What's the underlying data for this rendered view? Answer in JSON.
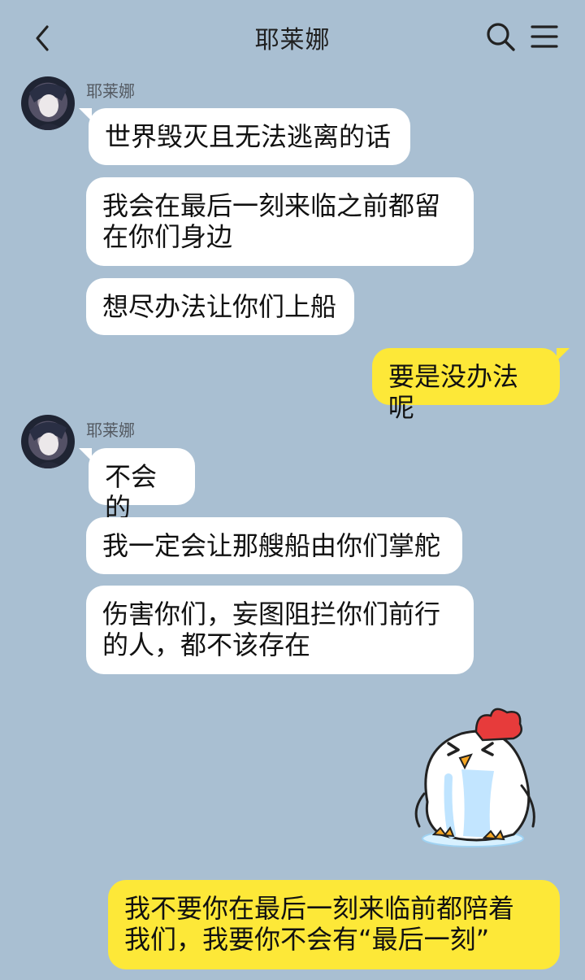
{
  "header": {
    "title": "耶莱娜",
    "back_icon": "chevron-left-icon",
    "search_icon": "search-icon",
    "menu_icon": "menu-icon"
  },
  "messages": [
    {
      "sender": "耶莱娜",
      "bubbles": [
        "世界毁灭且无法逃离的话",
        "我会在最后一刻来临之前都留\n在你们身边",
        "想尽办法让你们上船"
      ]
    },
    {
      "self": true,
      "text": "要是没办法呢"
    },
    {
      "sender": "耶莱娜",
      "bubbles": [
        "不会的",
        "我一定会让那艘船由你们掌舵",
        "伤害你们，妄图阻拦你们前行\n的人，都不该存在"
      ]
    },
    {
      "self": true,
      "sticker": "crying-chicken-sticker"
    },
    {
      "self": true,
      "text": "我不要你在最后一刻来临前都陪着\n我们，我要你不会有“最后一刻”"
    }
  ],
  "colors": {
    "background": "#a9bfd2",
    "incoming_bubble": "#ffffff",
    "outgoing_bubble": "#fde838"
  }
}
